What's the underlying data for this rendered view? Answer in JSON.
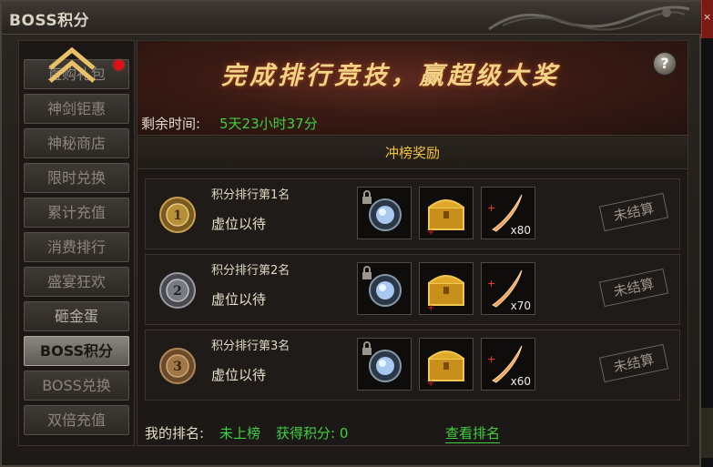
{
  "window": {
    "title": "BOSS积分"
  },
  "sidebar": {
    "items": [
      {
        "label": "直购礼包",
        "active": false,
        "badge": true
      },
      {
        "label": "神剑钜惠",
        "active": false
      },
      {
        "label": "神秘商店",
        "active": false
      },
      {
        "label": "限时兑换",
        "active": false
      },
      {
        "label": "累计充值",
        "active": false
      },
      {
        "label": "消费排行",
        "active": false
      },
      {
        "label": "盛宴狂欢",
        "active": false
      },
      {
        "label": "砸金蛋",
        "active": false
      },
      {
        "label": "BOSS积分",
        "active": true
      },
      {
        "label": "BOSS兑换",
        "active": false
      },
      {
        "label": "双倍充值",
        "active": false
      }
    ]
  },
  "banner": {
    "title": "完成排行竞技，赢超级大奖",
    "help": "?",
    "time_label": "剩余时间:",
    "time_value": "5天23小时37分"
  },
  "section": {
    "header": "冲榜奖励"
  },
  "rows": [
    {
      "medal": "1",
      "rank_title": "积分排行第1名",
      "name": "虚位以待",
      "count": "x80",
      "status": "未结算"
    },
    {
      "medal": "2",
      "rank_title": "积分排行第2名",
      "name": "虚位以待",
      "count": "x70",
      "status": "未结算"
    },
    {
      "medal": "3",
      "rank_title": "积分排行第3名",
      "name": "虚位以待",
      "count": "x60",
      "status": "未结算"
    }
  ],
  "footer": {
    "my_rank_label": "我的排名:",
    "my_rank_value": "未上榜",
    "score_label": "获得积分: 0",
    "view_rank": "查看排名"
  },
  "colors": {
    "accent_green": "#3fd03f",
    "gold": "#f1c23a",
    "banner_red": "#3a1a14"
  }
}
